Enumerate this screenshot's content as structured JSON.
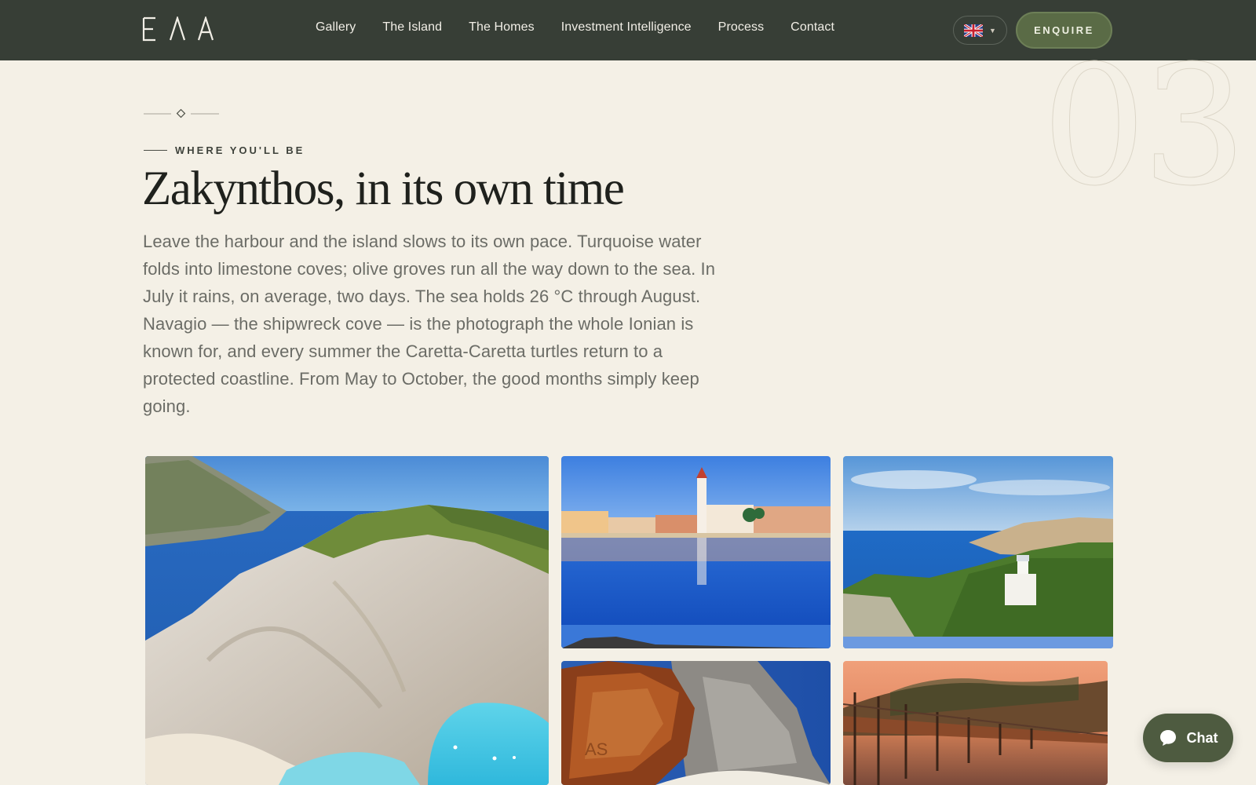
{
  "nav": {
    "logo_letters": [
      "Ε",
      "Λ",
      "Α"
    ],
    "links": [
      "Gallery",
      "The Island",
      "The Homes",
      "Investment Intelligence",
      "Process",
      "Contact"
    ],
    "language_icon": "uk-flag-icon",
    "enquire_label": "ENQUIRE"
  },
  "section": {
    "number": "03",
    "eyebrow": "WHERE YOU'LL BE",
    "title": "Zakynthos, in its own time",
    "body": "Leave the harbour and the island slows to its own pace. Turquoise water folds into limestone coves; olive groves run all the way down to the sea. In July it rains, on average, two days. The sea holds 26 °C through August. Navagio — the shipwreck cove — is the photograph the whole Ionian is known for, and every summer the Caretta-Caretta turtles return to a protected coastline. From May to October, the good months simply keep going."
  },
  "gallery": [
    "navagio-cliffs-photo",
    "harbour-bell-tower-photo",
    "lighthouse-coast-photo",
    "shipwreck-photo",
    "sunset-pier-photo"
  ],
  "chat": {
    "label": "Chat",
    "icon": "chat-bubble-icon"
  },
  "colors": {
    "nav_bg": "#373e36",
    "page_bg": "#f4f0e6",
    "accent_green": "#5a6b46"
  }
}
